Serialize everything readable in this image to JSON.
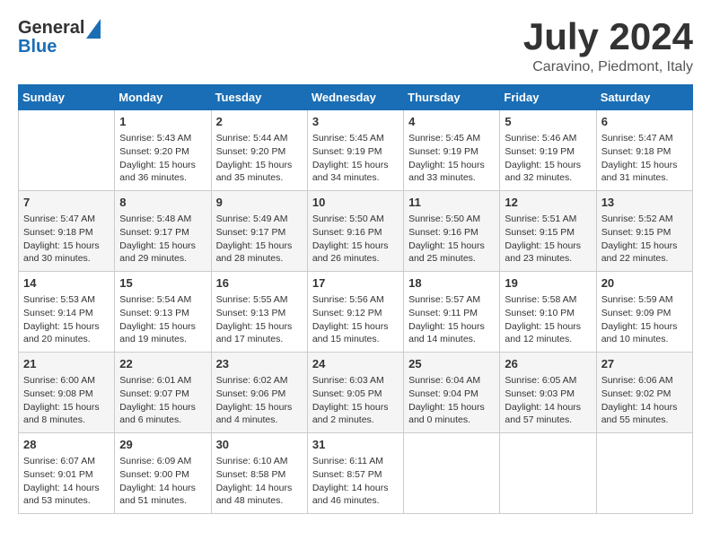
{
  "header": {
    "logo_line1": "General",
    "logo_line2": "Blue",
    "month": "July 2024",
    "location": "Caravino, Piedmont, Italy"
  },
  "weekdays": [
    "Sunday",
    "Monday",
    "Tuesday",
    "Wednesday",
    "Thursday",
    "Friday",
    "Saturday"
  ],
  "weeks": [
    [
      {
        "day": "",
        "info": ""
      },
      {
        "day": "1",
        "info": "Sunrise: 5:43 AM\nSunset: 9:20 PM\nDaylight: 15 hours\nand 36 minutes."
      },
      {
        "day": "2",
        "info": "Sunrise: 5:44 AM\nSunset: 9:20 PM\nDaylight: 15 hours\nand 35 minutes."
      },
      {
        "day": "3",
        "info": "Sunrise: 5:45 AM\nSunset: 9:19 PM\nDaylight: 15 hours\nand 34 minutes."
      },
      {
        "day": "4",
        "info": "Sunrise: 5:45 AM\nSunset: 9:19 PM\nDaylight: 15 hours\nand 33 minutes."
      },
      {
        "day": "5",
        "info": "Sunrise: 5:46 AM\nSunset: 9:19 PM\nDaylight: 15 hours\nand 32 minutes."
      },
      {
        "day": "6",
        "info": "Sunrise: 5:47 AM\nSunset: 9:18 PM\nDaylight: 15 hours\nand 31 minutes."
      }
    ],
    [
      {
        "day": "7",
        "info": "Sunrise: 5:47 AM\nSunset: 9:18 PM\nDaylight: 15 hours\nand 30 minutes."
      },
      {
        "day": "8",
        "info": "Sunrise: 5:48 AM\nSunset: 9:17 PM\nDaylight: 15 hours\nand 29 minutes."
      },
      {
        "day": "9",
        "info": "Sunrise: 5:49 AM\nSunset: 9:17 PM\nDaylight: 15 hours\nand 28 minutes."
      },
      {
        "day": "10",
        "info": "Sunrise: 5:50 AM\nSunset: 9:16 PM\nDaylight: 15 hours\nand 26 minutes."
      },
      {
        "day": "11",
        "info": "Sunrise: 5:50 AM\nSunset: 9:16 PM\nDaylight: 15 hours\nand 25 minutes."
      },
      {
        "day": "12",
        "info": "Sunrise: 5:51 AM\nSunset: 9:15 PM\nDaylight: 15 hours\nand 23 minutes."
      },
      {
        "day": "13",
        "info": "Sunrise: 5:52 AM\nSunset: 9:15 PM\nDaylight: 15 hours\nand 22 minutes."
      }
    ],
    [
      {
        "day": "14",
        "info": "Sunrise: 5:53 AM\nSunset: 9:14 PM\nDaylight: 15 hours\nand 20 minutes."
      },
      {
        "day": "15",
        "info": "Sunrise: 5:54 AM\nSunset: 9:13 PM\nDaylight: 15 hours\nand 19 minutes."
      },
      {
        "day": "16",
        "info": "Sunrise: 5:55 AM\nSunset: 9:13 PM\nDaylight: 15 hours\nand 17 minutes."
      },
      {
        "day": "17",
        "info": "Sunrise: 5:56 AM\nSunset: 9:12 PM\nDaylight: 15 hours\nand 15 minutes."
      },
      {
        "day": "18",
        "info": "Sunrise: 5:57 AM\nSunset: 9:11 PM\nDaylight: 15 hours\nand 14 minutes."
      },
      {
        "day": "19",
        "info": "Sunrise: 5:58 AM\nSunset: 9:10 PM\nDaylight: 15 hours\nand 12 minutes."
      },
      {
        "day": "20",
        "info": "Sunrise: 5:59 AM\nSunset: 9:09 PM\nDaylight: 15 hours\nand 10 minutes."
      }
    ],
    [
      {
        "day": "21",
        "info": "Sunrise: 6:00 AM\nSunset: 9:08 PM\nDaylight: 15 hours\nand 8 minutes."
      },
      {
        "day": "22",
        "info": "Sunrise: 6:01 AM\nSunset: 9:07 PM\nDaylight: 15 hours\nand 6 minutes."
      },
      {
        "day": "23",
        "info": "Sunrise: 6:02 AM\nSunset: 9:06 PM\nDaylight: 15 hours\nand 4 minutes."
      },
      {
        "day": "24",
        "info": "Sunrise: 6:03 AM\nSunset: 9:05 PM\nDaylight: 15 hours\nand 2 minutes."
      },
      {
        "day": "25",
        "info": "Sunrise: 6:04 AM\nSunset: 9:04 PM\nDaylight: 15 hours\nand 0 minutes."
      },
      {
        "day": "26",
        "info": "Sunrise: 6:05 AM\nSunset: 9:03 PM\nDaylight: 14 hours\nand 57 minutes."
      },
      {
        "day": "27",
        "info": "Sunrise: 6:06 AM\nSunset: 9:02 PM\nDaylight: 14 hours\nand 55 minutes."
      }
    ],
    [
      {
        "day": "28",
        "info": "Sunrise: 6:07 AM\nSunset: 9:01 PM\nDaylight: 14 hours\nand 53 minutes."
      },
      {
        "day": "29",
        "info": "Sunrise: 6:09 AM\nSunset: 9:00 PM\nDaylight: 14 hours\nand 51 minutes."
      },
      {
        "day": "30",
        "info": "Sunrise: 6:10 AM\nSunset: 8:58 PM\nDaylight: 14 hours\nand 48 minutes."
      },
      {
        "day": "31",
        "info": "Sunrise: 6:11 AM\nSunset: 8:57 PM\nDaylight: 14 hours\nand 46 minutes."
      },
      {
        "day": "",
        "info": ""
      },
      {
        "day": "",
        "info": ""
      },
      {
        "day": "",
        "info": ""
      }
    ]
  ]
}
